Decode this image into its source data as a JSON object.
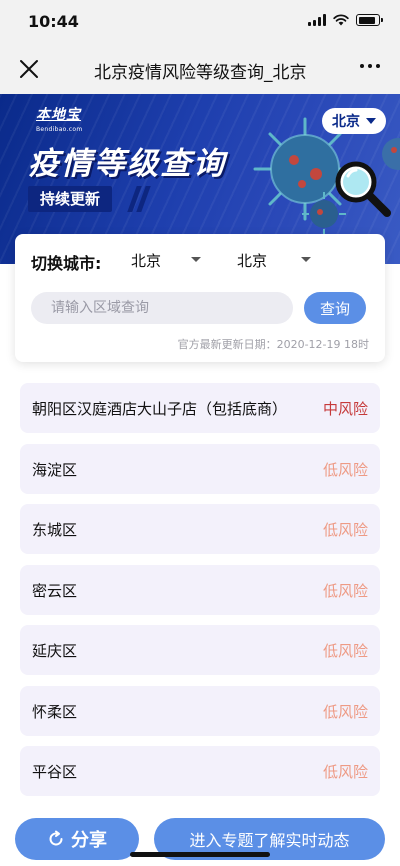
{
  "status_bar": {
    "time": "10:44"
  },
  "nav": {
    "title": "北京疫情风险等级查询_北京"
  },
  "banner": {
    "logo_text": "本地宝",
    "logo_sub": "Bendibao.com",
    "title": "疫情等级查询",
    "tagline": "持续更新",
    "city": "北京"
  },
  "search": {
    "switch_label": "切换城市:",
    "province": "北京",
    "city": "北京",
    "placeholder": "请输入区域查询",
    "button_label": "查询",
    "update_date": "官方最新更新日期：2020-12-19 18时"
  },
  "risk_areas": [
    {
      "area": "朝阳区汉庭酒店大山子店（包括底商）",
      "level": "中风险",
      "level_color": "#c63a3a"
    },
    {
      "area": "海淀区",
      "level": "低风险",
      "level_color": "#ee9a84"
    },
    {
      "area": "东城区",
      "level": "低风险",
      "level_color": "#ee9a84"
    },
    {
      "area": "密云区",
      "level": "低风险",
      "level_color": "#ee9a84"
    },
    {
      "area": "延庆区",
      "level": "低风险",
      "level_color": "#ee9a84"
    },
    {
      "area": "怀柔区",
      "level": "低风险",
      "level_color": "#ee9a84"
    },
    {
      "area": "平谷区",
      "level": "低风险",
      "level_color": "#ee9a84"
    }
  ],
  "bottom": {
    "share_label": "分享",
    "topic_label": "进入专题了解实时动态"
  },
  "colors": {
    "accent": "#5b8fe6",
    "banner_blue": "#1e3fae",
    "medium_risk": "#c63a3a",
    "low_risk": "#ee9a84"
  },
  "icons": [
    "close-icon",
    "more-icon",
    "signal-icon",
    "wifi-icon",
    "battery-icon",
    "caret-down-icon",
    "share-refresh-icon",
    "magnifier-icon",
    "virus-icon"
  ]
}
